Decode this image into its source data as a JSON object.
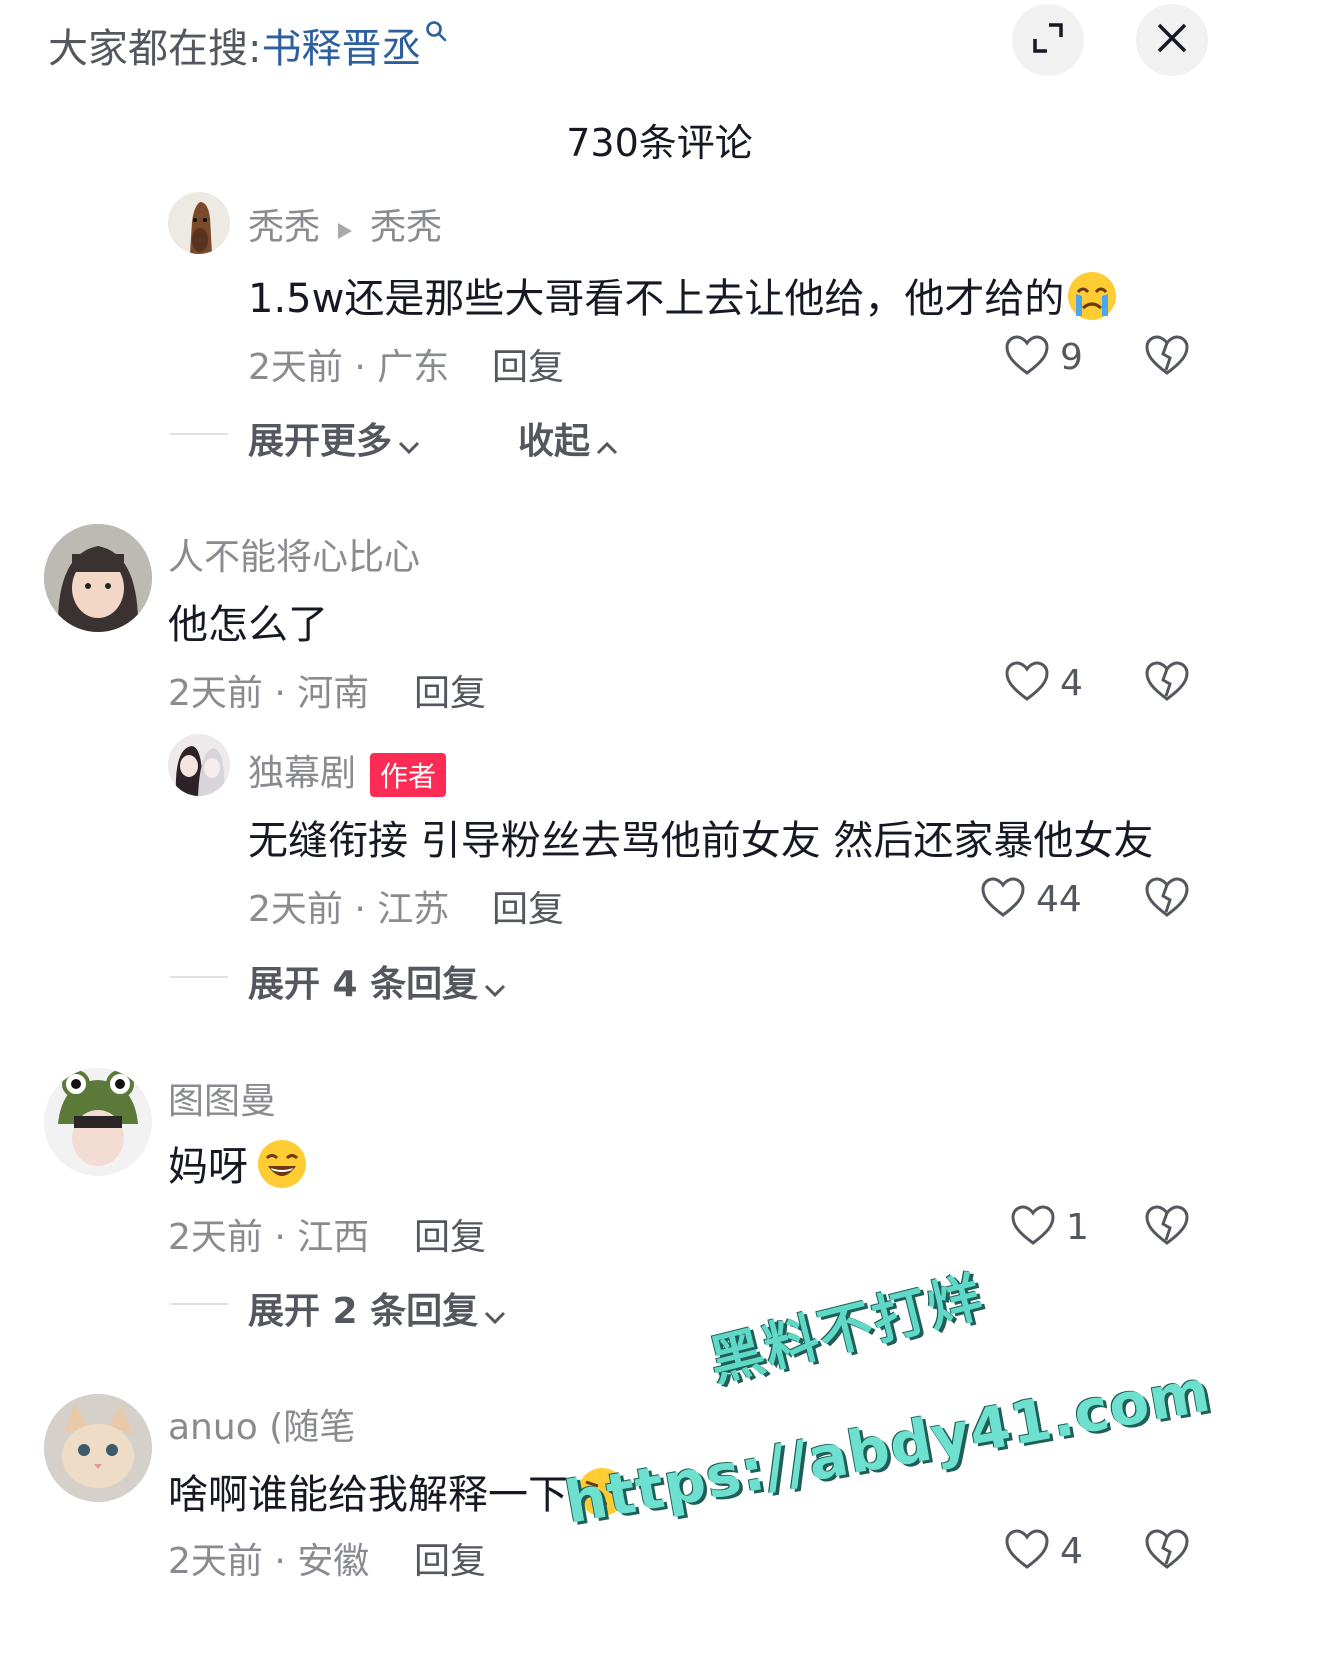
{
  "topbar": {
    "label": "大家都在搜:",
    "search_term": "书释晋丞",
    "expand_icon": "expand-icon",
    "close_icon": "close-icon"
  },
  "comment_count_title": "730条评论",
  "comments": [
    {
      "username": "秃秃",
      "reply_to": "秃秃",
      "text": "1.5w还是那些大哥看不上去让他给，他才给的",
      "emoji": "crying-emoji",
      "time_location": "2天前 · 广东",
      "reply_label": "回复",
      "likes": "9",
      "expand_more": "展开更多",
      "collapse": "收起"
    },
    {
      "username": "人不能将心比心",
      "text": "他怎么了",
      "time_location": "2天前 · 河南",
      "reply_label": "回复",
      "likes": "4"
    },
    {
      "username": "独幕剧",
      "badge": "作者",
      "text": "无缝衔接 引导粉丝去骂他前女友 然后还家暴他女友",
      "time_location": "2天前 · 江苏",
      "reply_label": "回复",
      "likes": "44",
      "expand": "展开 4 条回复"
    },
    {
      "username": "图图曼",
      "text": "妈呀",
      "emoji": "grinning-emoji",
      "time_location": "2天前 · 江西",
      "reply_label": "回复",
      "likes": "1",
      "expand": "展开 2 条回复"
    },
    {
      "username": "anuo (随笔",
      "text": "啥啊谁能给我解释一下",
      "emoji": "confused-emoji",
      "time_location": "2天前 · 安徽",
      "reply_label": "回复",
      "likes": "4"
    }
  ],
  "watermark": {
    "line1": "黑料不打烊",
    "line2": "https://abdy41.com"
  },
  "colors": {
    "accent": "#fe2c55",
    "search_term": "#2d5f9e",
    "muted": "#8a8b91",
    "watermark": "#5fd8c8"
  }
}
